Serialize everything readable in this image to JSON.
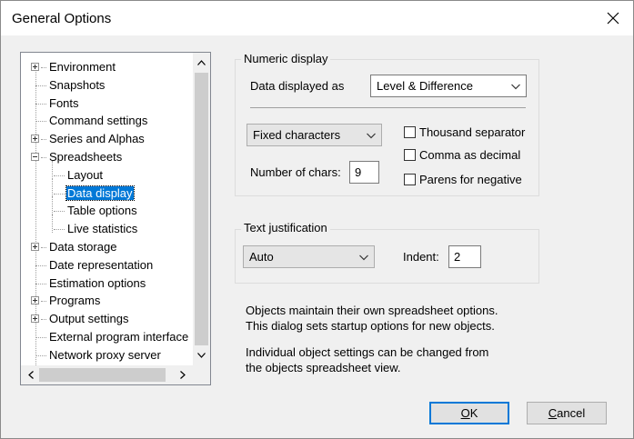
{
  "window": {
    "title": "General Options",
    "close_glyph": "✕"
  },
  "tree": {
    "items": [
      {
        "label": "Environment",
        "level": 0,
        "expander": "plus"
      },
      {
        "label": "Snapshots",
        "level": 0,
        "expander": "none"
      },
      {
        "label": "Fonts",
        "level": 0,
        "expander": "none"
      },
      {
        "label": "Command settings",
        "level": 0,
        "expander": "none"
      },
      {
        "label": "Series and Alphas",
        "level": 0,
        "expander": "plus"
      },
      {
        "label": "Spreadsheets",
        "level": 0,
        "expander": "minus"
      },
      {
        "label": "Layout",
        "level": 1,
        "expander": "none"
      },
      {
        "label": "Data display",
        "level": 1,
        "expander": "none",
        "selected": true
      },
      {
        "label": "Table options",
        "level": 1,
        "expander": "none"
      },
      {
        "label": "Live statistics",
        "level": 1,
        "expander": "none"
      },
      {
        "label": "Data storage",
        "level": 0,
        "expander": "plus"
      },
      {
        "label": "Date representation",
        "level": 0,
        "expander": "none"
      },
      {
        "label": "Estimation options",
        "level": 0,
        "expander": "none"
      },
      {
        "label": "Programs",
        "level": 0,
        "expander": "plus"
      },
      {
        "label": "Output settings",
        "level": 0,
        "expander": "plus"
      },
      {
        "label": "External program interface",
        "level": 0,
        "expander": "none"
      },
      {
        "label": "Network proxy server",
        "level": 0,
        "expander": "none"
      }
    ]
  },
  "numeric_display": {
    "group_label": "Numeric display",
    "data_displayed_as_label": "Data displayed as",
    "data_displayed_as_value": "Level & Difference",
    "format_value": "Fixed characters",
    "num_chars_label": "Number of chars:",
    "num_chars_value": "9",
    "thousand_separator": {
      "label": "Thousand separator",
      "checked": false
    },
    "comma_as_decimal": {
      "label": "Comma as decimal",
      "checked": false
    },
    "parens_for_negative": {
      "label": "Parens for negative",
      "checked": false
    }
  },
  "text_justification": {
    "group_label": "Text justification",
    "value": "Auto",
    "indent_label": "Indent:",
    "indent_value": "2"
  },
  "info": {
    "line1": "Objects maintain their own spreadsheet options.",
    "line2": "This dialog sets startup options for new objects.",
    "line3": "Individual object settings can be changed from",
    "line4": "the objects spreadsheet view."
  },
  "buttons": {
    "ok_mnemonic": "O",
    "ok_rest": "K",
    "cancel_mnemonic": "C",
    "cancel_rest": "ancel"
  },
  "colors": {
    "accent": "#0078d7",
    "background": "#f0f0f0"
  }
}
